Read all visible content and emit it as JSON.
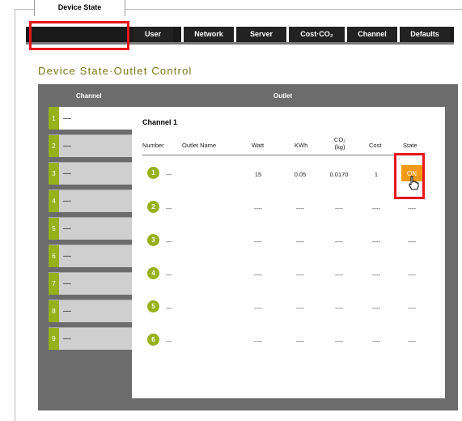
{
  "tabs": [
    {
      "label": "Device State",
      "active": true
    },
    {
      "label": "User"
    },
    {
      "label": "Network"
    },
    {
      "label": "Server"
    },
    {
      "label": "Cost·CO₂"
    },
    {
      "label": "Channel"
    },
    {
      "label": "Defaults"
    }
  ],
  "page_title": "Device State·Outlet Control",
  "channel_header": "Channel",
  "outlet_header": "Outlet",
  "channels": [
    {
      "num": "1",
      "name": "—",
      "active": true
    },
    {
      "num": "2",
      "name": "—"
    },
    {
      "num": "3",
      "name": "—"
    },
    {
      "num": "4",
      "name": "—"
    },
    {
      "num": "5",
      "name": "—"
    },
    {
      "num": "6",
      "name": "—"
    },
    {
      "num": "7",
      "name": "—"
    },
    {
      "num": "8",
      "name": "—"
    },
    {
      "num": "9",
      "name": "—"
    }
  ],
  "channel_title": "Channel 1",
  "columns": {
    "number": "Number",
    "outlet_name": "Outlet Name",
    "watt": "Watt",
    "kwh": "KWh",
    "co2_line1": "CO₂",
    "co2_line2": "(kg)",
    "cost": "Cost",
    "state": "State"
  },
  "rows": [
    {
      "num": "1",
      "name": "---",
      "watt": "15",
      "kwh": "0.05",
      "co2": "0.0170",
      "cost": "1",
      "state": "ON"
    },
    {
      "num": "2",
      "name": "---",
      "watt": "----",
      "kwh": "----",
      "co2": "----",
      "cost": "----",
      "state": "----"
    },
    {
      "num": "3",
      "name": "---",
      "watt": "----",
      "kwh": "----",
      "co2": "----",
      "cost": "----",
      "state": "----"
    },
    {
      "num": "4",
      "name": "---",
      "watt": "----",
      "kwh": "----",
      "co2": "----",
      "cost": "----",
      "state": "----"
    },
    {
      "num": "5",
      "name": "---",
      "watt": "----",
      "kwh": "----",
      "co2": "----",
      "cost": "----",
      "state": "----"
    },
    {
      "num": "6",
      "name": "---",
      "watt": "----",
      "kwh": "----",
      "co2": "----",
      "cost": "----",
      "state": "----"
    }
  ],
  "colors": {
    "accent_green": "#96b11a",
    "on_orange": "#f29a14",
    "highlight_red": "#e8141c",
    "title_olive": "#7a7418"
  },
  "icons": {
    "cursor": "hand-pointer-icon"
  }
}
